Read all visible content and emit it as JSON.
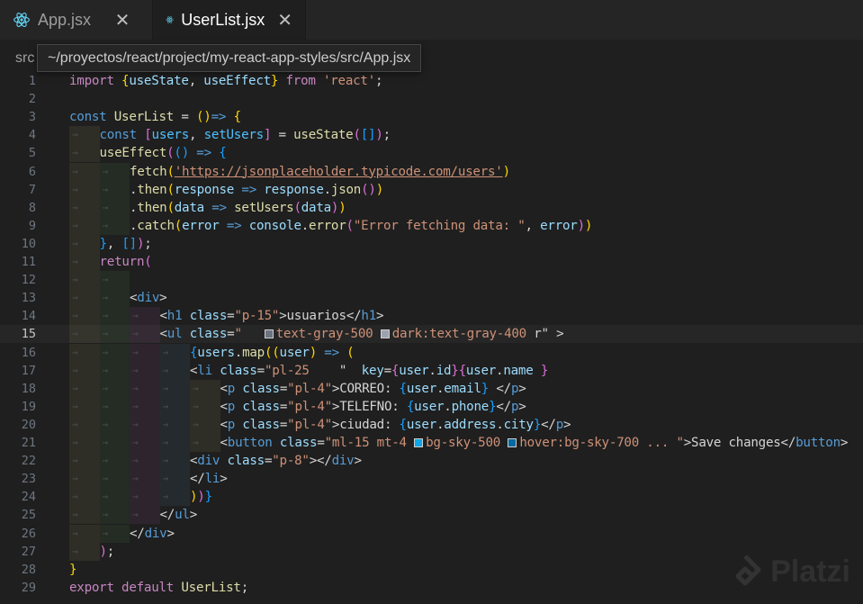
{
  "tabs": [
    {
      "label": "App.jsx",
      "active": false,
      "icon": "react-icon"
    },
    {
      "label": "UserList.jsx",
      "active": true,
      "icon": "react-icon"
    }
  ],
  "breadcrumb": "src",
  "tooltip": "~/proyectos/react/project/my-react-app-styles/src/App.jsx",
  "current_line": 15,
  "colors": {
    "swatch_gray_500": "#6b7280",
    "swatch_gray_400": "#9ca3af",
    "swatch_sky_500": "#0ea5e9",
    "swatch_sky_700": "#0369a1"
  },
  "lines": [
    {
      "n": "1",
      "tokens": [
        [
          "kc",
          "import "
        ],
        [
          "b1",
          "{"
        ],
        [
          "vr",
          "useState"
        ],
        [
          "pl",
          ", "
        ],
        [
          "vr",
          "useEffect"
        ],
        [
          "b1",
          "}"
        ],
        [
          "kc",
          " from "
        ],
        [
          "st",
          "'react'"
        ],
        [
          "pl",
          ";"
        ]
      ]
    },
    {
      "n": "2",
      "tokens": []
    },
    {
      "n": "3",
      "tokens": [
        [
          "kw",
          "const "
        ],
        [
          "fn",
          "UserList"
        ],
        [
          "pl",
          " = "
        ],
        [
          "b1",
          "()"
        ],
        [
          "kw",
          "=>"
        ],
        [
          "pl",
          " "
        ],
        [
          "b1",
          "{"
        ]
      ]
    },
    {
      "n": "4",
      "tokens": [
        [
          "kw",
          "const "
        ],
        [
          "b2",
          "["
        ],
        [
          "cn",
          "users"
        ],
        [
          "pl",
          ", "
        ],
        [
          "cn",
          "setUsers"
        ],
        [
          "b2",
          "]"
        ],
        [
          "pl",
          " = "
        ],
        [
          "fn",
          "useState"
        ],
        [
          "b2",
          "("
        ],
        [
          "b3",
          "[]"
        ],
        [
          "b2",
          ")"
        ],
        [
          "pl",
          ";"
        ]
      ]
    },
    {
      "n": "5",
      "tokens": [
        [
          "fn",
          "useEffect"
        ],
        [
          "b2",
          "("
        ],
        [
          "b3",
          "()"
        ],
        [
          "kw",
          " => "
        ],
        [
          "b3",
          "{"
        ]
      ]
    },
    {
      "n": "6",
      "tokens": [
        [
          "fn",
          "fetch"
        ],
        [
          "b1",
          "("
        ],
        [
          "st link",
          "'https://jsonplaceholder.typicode.com/users'"
        ],
        [
          "b1",
          ")"
        ]
      ]
    },
    {
      "n": "7",
      "tokens": [
        [
          "pl",
          "."
        ],
        [
          "fn",
          "then"
        ],
        [
          "b1",
          "("
        ],
        [
          "vr",
          "response"
        ],
        [
          "kw",
          " => "
        ],
        [
          "vr",
          "response"
        ],
        [
          "pl",
          "."
        ],
        [
          "fn",
          "json"
        ],
        [
          "b2",
          "()"
        ],
        [
          "b1",
          ")"
        ]
      ]
    },
    {
      "n": "8",
      "tokens": [
        [
          "pl",
          "."
        ],
        [
          "fn",
          "then"
        ],
        [
          "b1",
          "("
        ],
        [
          "vr",
          "data"
        ],
        [
          "kw",
          " => "
        ],
        [
          "fn",
          "setUsers"
        ],
        [
          "b2",
          "("
        ],
        [
          "vr",
          "data"
        ],
        [
          "b2",
          ")"
        ],
        [
          "b1",
          ")"
        ]
      ]
    },
    {
      "n": "9",
      "tokens": [
        [
          "pl",
          "."
        ],
        [
          "fn",
          "catch"
        ],
        [
          "b1",
          "("
        ],
        [
          "vr",
          "error"
        ],
        [
          "kw",
          " => "
        ],
        [
          "vr",
          "console"
        ],
        [
          "pl",
          "."
        ],
        [
          "fn",
          "error"
        ],
        [
          "b2",
          "("
        ],
        [
          "st",
          "\"Error fetching data: \""
        ],
        [
          "pl",
          ", "
        ],
        [
          "vr",
          "error"
        ],
        [
          "b2",
          ")"
        ],
        [
          "b1",
          ")"
        ]
      ]
    },
    {
      "n": "10",
      "tokens": [
        [
          "b3",
          "}"
        ],
        [
          "pl",
          ", "
        ],
        [
          "b3",
          "[]"
        ],
        [
          "b2",
          ")"
        ],
        [
          "pl",
          ";"
        ]
      ]
    },
    {
      "n": "11",
      "tokens": [
        [
          "kc",
          "return"
        ],
        [
          "b2",
          "("
        ]
      ]
    },
    {
      "n": "12",
      "tokens": []
    },
    {
      "n": "13",
      "tokens": [
        [
          "pl",
          "<"
        ],
        [
          "tg",
          "div"
        ],
        [
          "pl",
          ">"
        ]
      ]
    },
    {
      "n": "14",
      "tokens": [
        [
          "pl",
          "<"
        ],
        [
          "tg",
          "h1"
        ],
        [
          "pl",
          " "
        ],
        [
          "at",
          "class"
        ],
        [
          "pl",
          "="
        ],
        [
          "st",
          "\"p-15\""
        ],
        [
          "pl",
          ">usuarios</"
        ],
        [
          "tg",
          "h1"
        ],
        [
          "pl",
          ">"
        ]
      ]
    },
    {
      "n": "15",
      "tokens": [
        [
          "pl",
          "<"
        ],
        [
          "tg",
          "ul"
        ],
        [
          "pl",
          " "
        ],
        [
          "at",
          "class"
        ],
        [
          "pl",
          "="
        ],
        [
          "st",
          "\""
        ],
        [
          "pl",
          "   "
        ],
        [
          "swatch",
          "swatch_gray_500"
        ],
        [
          "st",
          "text-gray-500 "
        ],
        [
          "swatch",
          "swatch_gray_400"
        ],
        [
          "st",
          "dark:text-gray-400 "
        ],
        [
          "pl",
          "r\" "
        ],
        [
          "pl",
          ">"
        ]
      ]
    },
    {
      "n": "16",
      "tokens": [
        [
          "b3",
          "{"
        ],
        [
          "vr",
          "users"
        ],
        [
          "pl",
          "."
        ],
        [
          "fn",
          "map"
        ],
        [
          "b1",
          "(("
        ],
        [
          "vr",
          "user"
        ],
        [
          "b1",
          ")"
        ],
        [
          "kw",
          " => "
        ],
        [
          "b1",
          "("
        ]
      ]
    },
    {
      "n": "17",
      "tokens": [
        [
          "pl",
          "<"
        ],
        [
          "tg",
          "li"
        ],
        [
          "pl",
          " "
        ],
        [
          "at",
          "class"
        ],
        [
          "pl",
          "="
        ],
        [
          "st",
          "\"pl-25 "
        ],
        [
          "pl",
          "   \"  "
        ],
        [
          "at",
          "key"
        ],
        [
          "pl",
          "="
        ],
        [
          "b2",
          "{"
        ],
        [
          "vr",
          "user"
        ],
        [
          "pl",
          "."
        ],
        [
          "vr",
          "id"
        ],
        [
          "b2",
          "}"
        ],
        [
          "b2",
          "{"
        ],
        [
          "vr",
          "user"
        ],
        [
          "pl",
          "."
        ],
        [
          "vr",
          "name"
        ],
        [
          "pl",
          " "
        ],
        [
          "b2",
          "}"
        ]
      ]
    },
    {
      "n": "18",
      "tokens": [
        [
          "pl",
          "<"
        ],
        [
          "tg",
          "p"
        ],
        [
          "pl",
          " "
        ],
        [
          "at",
          "class"
        ],
        [
          "pl",
          "="
        ],
        [
          "st",
          "\"pl-4\""
        ],
        [
          "pl",
          ">CORREO: "
        ],
        [
          "b3",
          "{"
        ],
        [
          "vr",
          "user"
        ],
        [
          "pl",
          "."
        ],
        [
          "vr",
          "email"
        ],
        [
          "b3",
          "}"
        ],
        [
          "pl",
          " </"
        ],
        [
          "tg",
          "p"
        ],
        [
          "pl",
          ">"
        ]
      ]
    },
    {
      "n": "19",
      "tokens": [
        [
          "pl",
          "<"
        ],
        [
          "tg",
          "p"
        ],
        [
          "pl",
          " "
        ],
        [
          "at",
          "class"
        ],
        [
          "pl",
          "="
        ],
        [
          "st",
          "\"pl-4\""
        ],
        [
          "pl",
          ">TELEFNO: "
        ],
        [
          "b3",
          "{"
        ],
        [
          "vr",
          "user"
        ],
        [
          "pl",
          "."
        ],
        [
          "vr",
          "phone"
        ],
        [
          "b3",
          "}"
        ],
        [
          "pl",
          "</"
        ],
        [
          "tg",
          "p"
        ],
        [
          "pl",
          ">"
        ]
      ]
    },
    {
      "n": "20",
      "tokens": [
        [
          "pl",
          "<"
        ],
        [
          "tg",
          "p"
        ],
        [
          "pl",
          " "
        ],
        [
          "at",
          "class"
        ],
        [
          "pl",
          "="
        ],
        [
          "st",
          "\"pl-4\""
        ],
        [
          "pl",
          ">ciudad: "
        ],
        [
          "b3",
          "{"
        ],
        [
          "vr",
          "user"
        ],
        [
          "pl",
          "."
        ],
        [
          "vr",
          "address"
        ],
        [
          "pl",
          "."
        ],
        [
          "vr",
          "city"
        ],
        [
          "b3",
          "}"
        ],
        [
          "pl",
          "</"
        ],
        [
          "tg",
          "p"
        ],
        [
          "pl",
          ">"
        ]
      ]
    },
    {
      "n": "21",
      "tokens": [
        [
          "pl",
          "<"
        ],
        [
          "tg",
          "button"
        ],
        [
          "pl",
          " "
        ],
        [
          "at",
          "class"
        ],
        [
          "pl",
          "="
        ],
        [
          "st",
          "\"ml-15 mt-4 "
        ],
        [
          "swatch",
          "swatch_sky_500"
        ],
        [
          "st",
          "bg-sky-500 "
        ],
        [
          "swatch",
          "swatch_sky_700"
        ],
        [
          "st",
          "hover:bg-sky-700 ... \""
        ],
        [
          "pl",
          ">Save changes</"
        ],
        [
          "tg",
          "button"
        ],
        [
          "pl",
          ">"
        ]
      ]
    },
    {
      "n": "22",
      "tokens": [
        [
          "pl",
          "<"
        ],
        [
          "tg",
          "div"
        ],
        [
          "pl",
          " "
        ],
        [
          "at",
          "class"
        ],
        [
          "pl",
          "="
        ],
        [
          "st",
          "\"p-8\""
        ],
        [
          "pl",
          "></"
        ],
        [
          "tg",
          "div"
        ],
        [
          "pl",
          ">"
        ]
      ]
    },
    {
      "n": "23",
      "tokens": [
        [
          "pl",
          "</"
        ],
        [
          "tg",
          "li"
        ],
        [
          "pl",
          ">"
        ]
      ]
    },
    {
      "n": "24",
      "tokens": [
        [
          "b1",
          ")"
        ],
        [
          "b2",
          ")"
        ],
        [
          "b3",
          "}"
        ]
      ]
    },
    {
      "n": "25",
      "tokens": [
        [
          "pl",
          "</"
        ],
        [
          "tg",
          "ul"
        ],
        [
          "pl",
          ">"
        ]
      ]
    },
    {
      "n": "26",
      "tokens": [
        [
          "pl",
          "</"
        ],
        [
          "tg",
          "div"
        ],
        [
          "pl",
          ">"
        ]
      ]
    },
    {
      "n": "27",
      "tokens": [
        [
          "b2",
          ")"
        ],
        [
          "pl",
          ";"
        ]
      ]
    },
    {
      "n": "28",
      "tokens": [
        [
          "b1",
          "}"
        ]
      ]
    },
    {
      "n": "29",
      "tokens": [
        [
          "kc",
          "export "
        ],
        [
          "kc",
          "default "
        ],
        [
          "fn",
          "UserList"
        ],
        [
          "pl",
          ";"
        ]
      ]
    }
  ],
  "watermark": "Platzi"
}
